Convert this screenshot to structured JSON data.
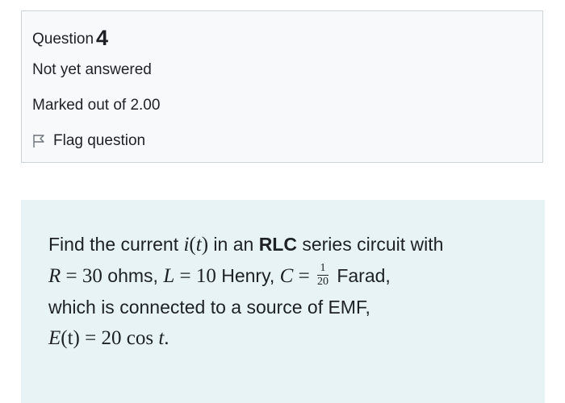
{
  "question_info": {
    "question_label": "Question",
    "question_number": "4",
    "state": "Not yet answered",
    "grade": "Marked out of 2.00",
    "flag_label": "Flag question",
    "flag_icon": "flag-outline-icon"
  },
  "question": {
    "line1_pre": "Find the current ",
    "current_fn": "i",
    "current_arg": "(t)",
    "line1_mid": " in an ",
    "line1_bold": "RLC",
    "line1_post": " series circuit with",
    "r_symbol": "R",
    "r_value": " = 30",
    "r_unit": " ohms, ",
    "l_symbol": "L",
    "l_value": " = 10",
    "l_unit": " Henry,  ",
    "c_symbol": "C",
    "c_eq": " = ",
    "c_num": "1",
    "c_den": "20",
    "c_unit": " Farad,",
    "line3": "which is connected to a source of EMF,",
    "emf_symbol": "E",
    "emf_expr": "(t) = 20 cos ",
    "emf_var": "t",
    "emf_end": "."
  },
  "colors": {
    "info_bg": "#f8f9fa",
    "info_border": "#cfd4d8",
    "content_bg": "#e7f3f5",
    "text": "#1d2125"
  }
}
